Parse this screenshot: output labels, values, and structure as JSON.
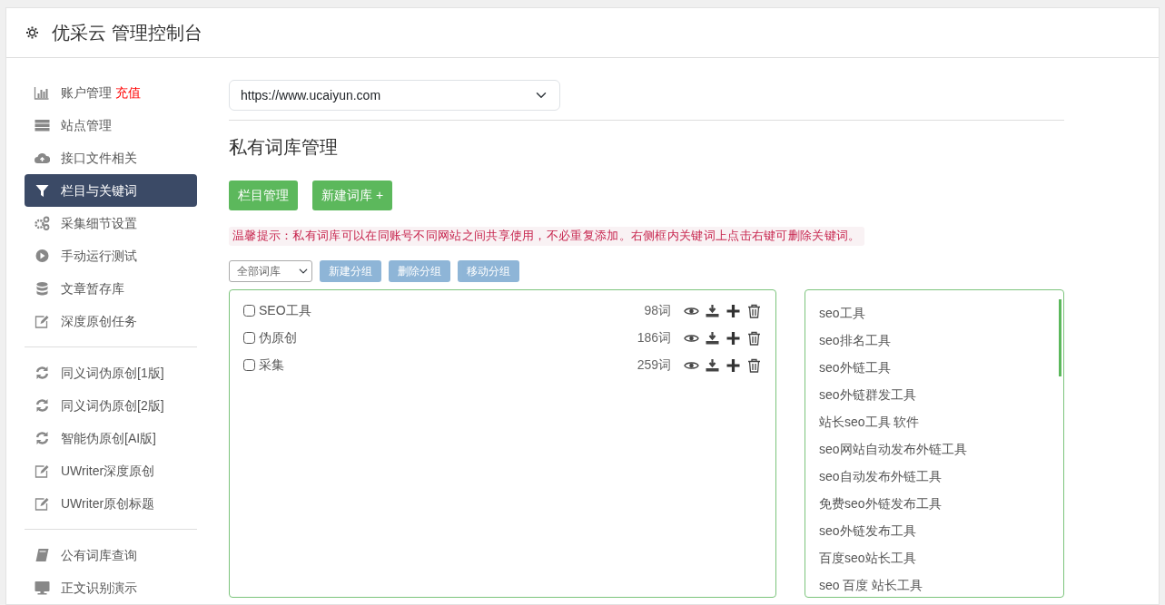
{
  "header": {
    "title": "优采云 管理控制台"
  },
  "sidebar": {
    "groups": [
      {
        "items": [
          {
            "label": "账户管理",
            "badge": "充值",
            "selected": false
          },
          {
            "label": "站点管理",
            "selected": false
          },
          {
            "label": "接口文件相关",
            "selected": false
          },
          {
            "label": "栏目与关键词",
            "selected": true
          },
          {
            "label": "采集细节设置",
            "selected": false
          },
          {
            "label": "手动运行测试",
            "selected": false
          },
          {
            "label": "文章暂存库",
            "selected": false
          },
          {
            "label": "深度原创任务",
            "selected": false
          }
        ]
      },
      {
        "items": [
          {
            "label": "同义词伪原创[1版]",
            "selected": false
          },
          {
            "label": "同义词伪原创[2版]",
            "selected": false
          },
          {
            "label": "智能伪原创[AI版]",
            "selected": false
          },
          {
            "label": "UWriter深度原创",
            "selected": false
          },
          {
            "label": "UWriter原创标题",
            "selected": false
          }
        ]
      },
      {
        "items": [
          {
            "label": "公有词库查询",
            "selected": false
          },
          {
            "label": "正文识别演示",
            "selected": false
          }
        ]
      }
    ]
  },
  "site_select": {
    "value": "https://www.ucaiyun.com"
  },
  "heading": "私有词库管理",
  "actions": [
    {
      "label": "栏目管理"
    },
    {
      "label": "新建词库 +"
    }
  ],
  "tip": "温馨提示：私有词库可以在同账号不同网站之间共享使用，不必重复添加。右侧框内关键词上点击右键可删除关键词。",
  "toolbar": {
    "filter": "全部词库",
    "buttons": [
      {
        "label": "新建分组",
        "disabled": true
      },
      {
        "label": "删除分组",
        "disabled": true
      },
      {
        "label": "移动分组",
        "disabled": true
      }
    ]
  },
  "word_groups": [
    {
      "name": "SEO工具",
      "count": "98词",
      "checked": false
    },
    {
      "name": "伪原创",
      "count": "186词",
      "checked": false
    },
    {
      "name": "采集",
      "count": "259词",
      "checked": false
    }
  ],
  "keywords": [
    "seo工具",
    "seo排名工具",
    "seo外链工具",
    "seo外链群发工具",
    "站长seo工具 软件",
    "seo网站自动发布外链工具",
    "seo自动发布外链工具",
    "免费seo外链发布工具",
    "seo外链发布工具",
    "百度seo站长工具",
    "seo 百度 站长工具"
  ]
}
